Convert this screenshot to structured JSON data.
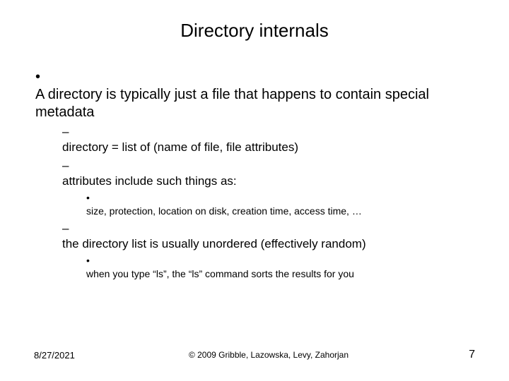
{
  "title": "Directory internals",
  "bullets": {
    "l1": "A directory is typically just a file that happens to contain special metadata",
    "l2a": "directory = list of (name of file, file attributes)",
    "l2b": "attributes include such things as:",
    "l3a": "size, protection, location on disk, creation time, access time, …",
    "l2c": "the directory list is usually unordered (effectively random)",
    "l3b": "when you type “ls”, the “ls” command sorts the results for you"
  },
  "footer": {
    "date": "8/27/2021",
    "copyright": "© 2009 Gribble, Lazowska, Levy, Zahorjan",
    "page": "7"
  }
}
